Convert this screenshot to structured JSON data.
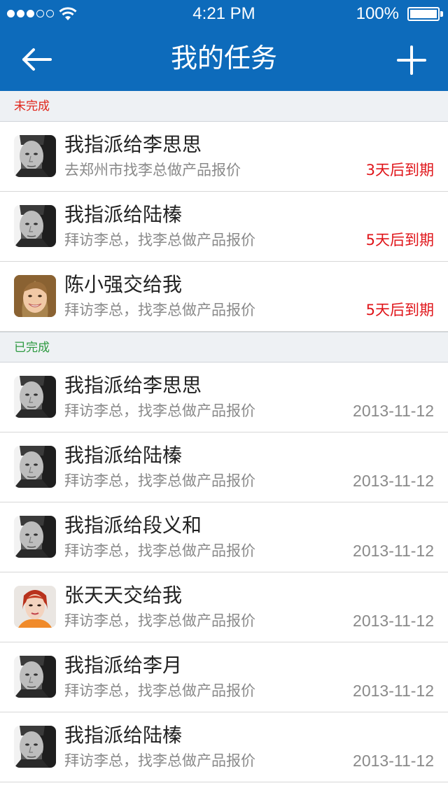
{
  "status_bar": {
    "time": "4:21 PM",
    "battery": "100%"
  },
  "nav": {
    "title": "我的任务",
    "back_icon": "arrow-left-icon",
    "add_icon": "plus-icon"
  },
  "sections": [
    {
      "label": "未完成",
      "color": "#e0251a",
      "items": [
        {
          "title": "我指派给李思思",
          "subtitle": "去郑州市找李总做产品报价",
          "meta": "3天后到期",
          "avatar": "man"
        },
        {
          "title": "我指派给陆榛",
          "subtitle": "拜访李总，找李总做产品报价",
          "meta": "5天后到期",
          "avatar": "man"
        },
        {
          "title": "陈小强交给我",
          "subtitle": "拜访李总，找李总做产品报价",
          "meta": "5天后到期",
          "avatar": "woman-smiling"
        }
      ]
    },
    {
      "label": "已完成",
      "color": "#2d9a41",
      "items": [
        {
          "title": "我指派给李思思",
          "subtitle": "拜访李总，找李总做产品报价",
          "meta": "2013-11-12",
          "avatar": "man"
        },
        {
          "title": "我指派给陆榛",
          "subtitle": "拜访李总，找李总做产品报价",
          "meta": "2013-11-12",
          "avatar": "man"
        },
        {
          "title": "我指派给段义和",
          "subtitle": "拜访李总，找李总做产品报价",
          "meta": "2013-11-12",
          "avatar": "man"
        },
        {
          "title": "张天天交给我",
          "subtitle": "拜访李总，找李总做产品报价",
          "meta": "2013-11-12",
          "avatar": "woman-redhair"
        },
        {
          "title": "我指派给李月",
          "subtitle": "拜访李总，找李总做产品报价",
          "meta": "2013-11-12",
          "avatar": "man"
        },
        {
          "title": "我指派给陆榛",
          "subtitle": "拜访李总，找李总做产品报价",
          "meta": "2013-11-12",
          "avatar": "man"
        }
      ]
    }
  ],
  "colors": {
    "header": "#0d6bbb",
    "due": "#e0151a",
    "date": "#8a8a8a"
  }
}
